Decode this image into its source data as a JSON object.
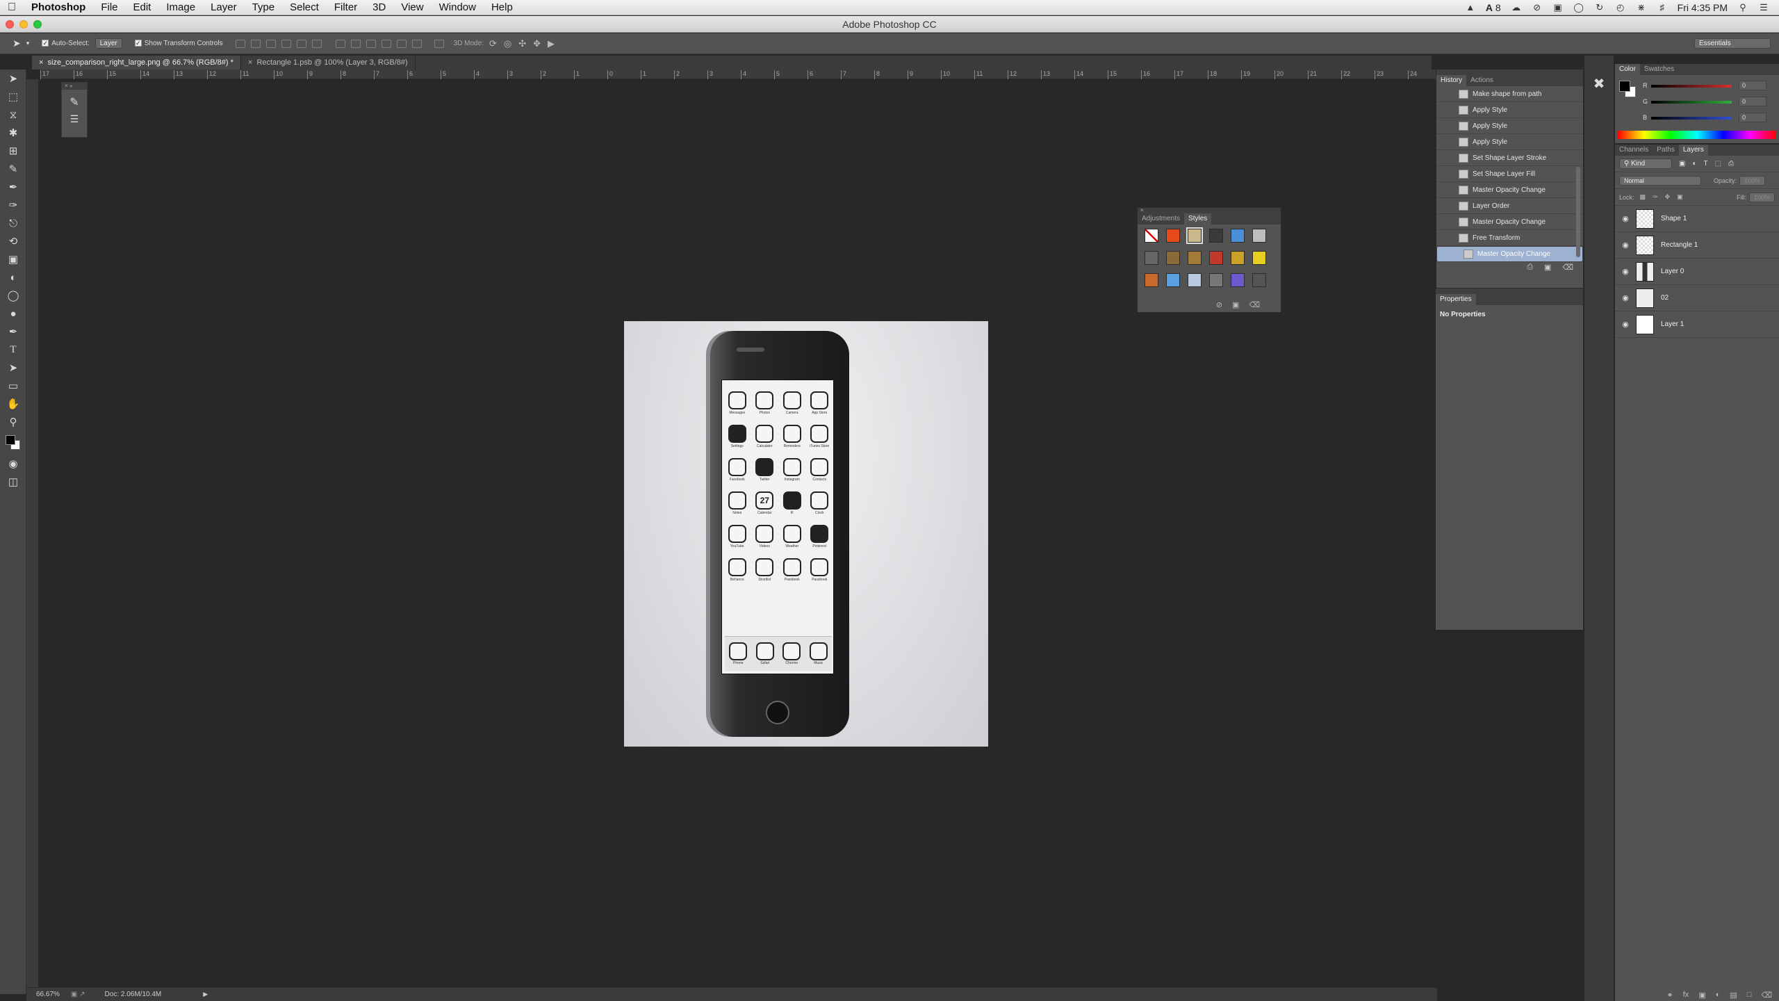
{
  "menubar": {
    "app": "Photoshop",
    "items": [
      "File",
      "Edit",
      "Image",
      "Layer",
      "Type",
      "Select",
      "Filter",
      "3D",
      "View",
      "Window",
      "Help"
    ],
    "badge_count": "8",
    "clock": "Fri 4:35 PM"
  },
  "window": {
    "title": "Adobe Photoshop CC"
  },
  "options": {
    "auto_select_label": "Auto-Select:",
    "auto_select_value": "Layer",
    "show_transform_label": "Show Transform Controls",
    "mode3d_label": "3D Mode:",
    "workspace": "Essentials"
  },
  "tabs": [
    {
      "label": "size_comparison_right_large.png @ 66.7% (RGB/8#) *"
    },
    {
      "label": "Rectangle 1.psb @ 100% (Layer 3, RGB/8#)"
    }
  ],
  "ruler_ticks": [
    "17",
    "16",
    "15",
    "14",
    "13",
    "12",
    "11",
    "10",
    "9",
    "8",
    "7",
    "6",
    "5",
    "4",
    "3",
    "2",
    "1",
    "0",
    "1",
    "2",
    "3",
    "4",
    "5",
    "6",
    "7",
    "8",
    "9",
    "10",
    "11",
    "12",
    "13",
    "14",
    "15",
    "16",
    "17",
    "18",
    "19",
    "20",
    "21",
    "22",
    "23",
    "24"
  ],
  "statusbar": {
    "zoom": "66.67%",
    "doc": "Doc: 2.06M/10.4M"
  },
  "styles_panel": {
    "tabs": [
      "Adjustments",
      "Styles"
    ],
    "swatch_colors": [
      "#ffffff",
      "#e64a19",
      "#c9b98a",
      "#3a3a3a",
      "#4a8fd8",
      "#bdbdbd",
      "#666666",
      "#8a6a3a",
      "#a37a3a",
      "#c0392b",
      "#c9a227",
      "#e5d020",
      "#c96a2a",
      "#5aa0e0",
      "#b8c9e0",
      "#777777",
      "#6a5acd",
      "#555555"
    ]
  },
  "history": {
    "tabs": [
      "History",
      "Actions"
    ],
    "items": [
      "Make shape from path",
      "Apply Style",
      "Apply Style",
      "Apply Style",
      "Set Shape Layer Stroke",
      "Set Shape Layer Fill",
      "Master Opacity Change",
      "Layer Order",
      "Master Opacity Change",
      "Free Transform",
      "Master Opacity Change"
    ]
  },
  "properties": {
    "title": "Properties",
    "empty": "No Properties"
  },
  "color_panel": {
    "tabs": [
      "Color",
      "Swatches"
    ],
    "channels": [
      {
        "label": "R",
        "value": "0",
        "color": "#d83030"
      },
      {
        "label": "G",
        "value": "0",
        "color": "#30b040"
      },
      {
        "label": "B",
        "value": "0",
        "color": "#3050d8"
      }
    ]
  },
  "layers_panel": {
    "tabs": [
      "Channels",
      "Paths",
      "Layers"
    ],
    "kind": "Kind",
    "blend": "Normal",
    "opacity_label": "Opacity:",
    "opacity_value": "100%",
    "lock_label": "Lock:",
    "fill_label": "Fill:",
    "fill_value": "100%",
    "layers": [
      "Shape 1",
      "Rectangle 1",
      "Layer 0",
      "02",
      "Layer 1"
    ]
  },
  "phone": {
    "apps": [
      "Messages",
      "Photos",
      "Camera",
      "App Store",
      "Settings",
      "Calculator",
      "Reminders",
      "iTunes Store",
      "Facebook",
      "Twitter",
      "Instagram",
      "Contacts",
      "Notes",
      "Calendar",
      "IF",
      "Clock",
      "YouTube",
      "Videos",
      "Weather",
      "Pinterest",
      "Behance",
      "Shortlist",
      "Passbook",
      "Passbook"
    ],
    "dock": [
      "Phone",
      "Safari",
      "Chrome",
      "Music"
    ],
    "calendar_day": "27"
  }
}
